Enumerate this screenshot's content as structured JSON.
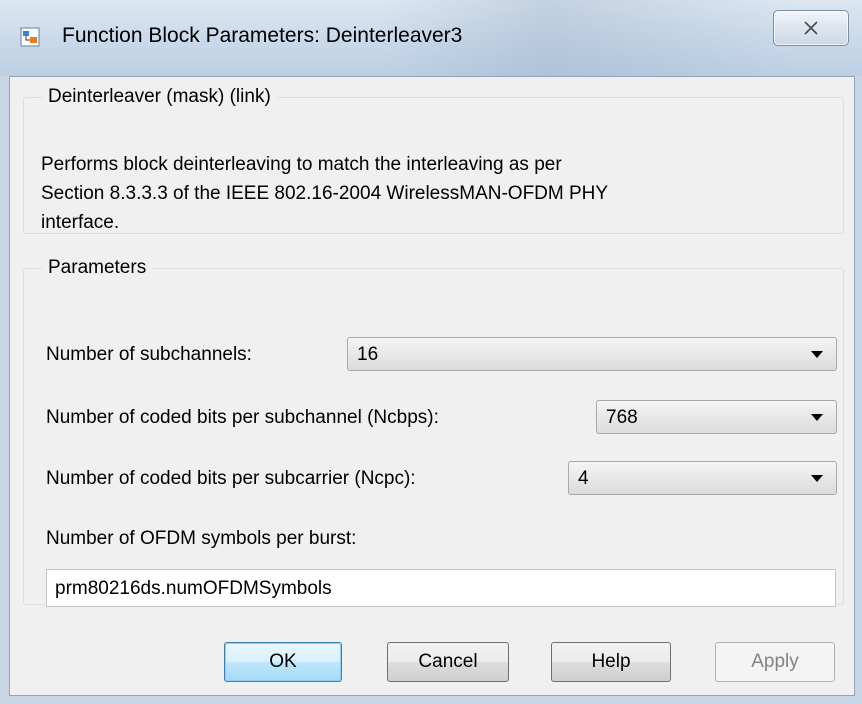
{
  "window": {
    "title": "Function Block Parameters: Deinterleaver3",
    "icon": "simulink-block-icon",
    "close_icon": "close-icon"
  },
  "description_group": {
    "legend": "Deinterleaver (mask) (link)",
    "lines": [
      "Performs block deinterleaving to match the interleaving as per",
      "Section 8.3.3.3 of the IEEE 802.16-2004 WirelessMAN-OFDM PHY",
      "interface."
    ]
  },
  "parameters_group": {
    "legend": "Parameters",
    "subchannels": {
      "label": "Number of subchannels:",
      "value": "16"
    },
    "ncbps": {
      "label": "Number of coded bits per subchannel (Ncbps):",
      "value": "768"
    },
    "ncpc": {
      "label": "Number of coded bits per subcarrier (Ncpc):",
      "value": "4"
    },
    "ofdm_symbols": {
      "label": "Number of OFDM symbols per burst:",
      "value": "prm80216ds.numOFDMSymbols"
    }
  },
  "buttons": {
    "ok": "OK",
    "cancel": "Cancel",
    "help": "Help",
    "apply": "Apply"
  },
  "colors": {
    "titlebar": "#c9d9ea",
    "client_bg": "#f0f0f0",
    "default_button_border": "#3c7fb1",
    "disabled_text": "#838383"
  }
}
